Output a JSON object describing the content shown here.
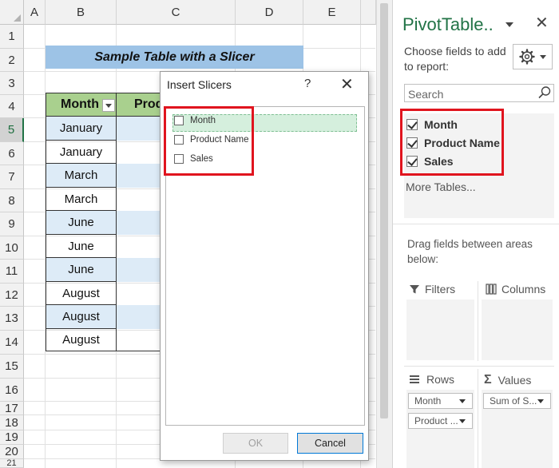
{
  "sheet": {
    "columns": [
      "A",
      "B",
      "C",
      "D",
      "E"
    ],
    "rows": [
      "1",
      "2",
      "3",
      "4",
      "5",
      "6",
      "7",
      "8",
      "9",
      "10",
      "11",
      "12",
      "13",
      "14",
      "15",
      "16",
      "17",
      "18",
      "19",
      "20",
      "21"
    ],
    "title": "Sample Table with a Slicer",
    "table": {
      "headers": [
        "Month",
        "Prod"
      ],
      "months": [
        "January",
        "January",
        "March",
        "March",
        "June",
        "June",
        "June",
        "August",
        "August",
        "August"
      ]
    }
  },
  "dialog": {
    "title": "Insert Slicers",
    "help": "?",
    "close": "✕",
    "items": [
      "Month",
      "Product Name",
      "Sales"
    ],
    "ok_label": "OK",
    "cancel_label": "Cancel"
  },
  "pane": {
    "title": "PivotTable..",
    "close": "✕",
    "choose_text": "Choose fields to add to report:",
    "search_placeholder": "Search",
    "fields": [
      "Month",
      "Product Name",
      "Sales"
    ],
    "more_tables": "More Tables...",
    "drag_text": "Drag fields between areas below:",
    "areas": {
      "filters": "Filters",
      "columns": "Columns",
      "rows": "Rows",
      "values": "Values"
    },
    "rows_items": [
      "Month",
      "Product ..."
    ],
    "values_items": [
      "Sum of S..."
    ]
  },
  "colors": {
    "accent": "#217346",
    "header_green": "#a9d08e",
    "title_blue": "#9dc3e6",
    "band_blue": "#ddebf7",
    "highlight_red": "#e0141e"
  }
}
